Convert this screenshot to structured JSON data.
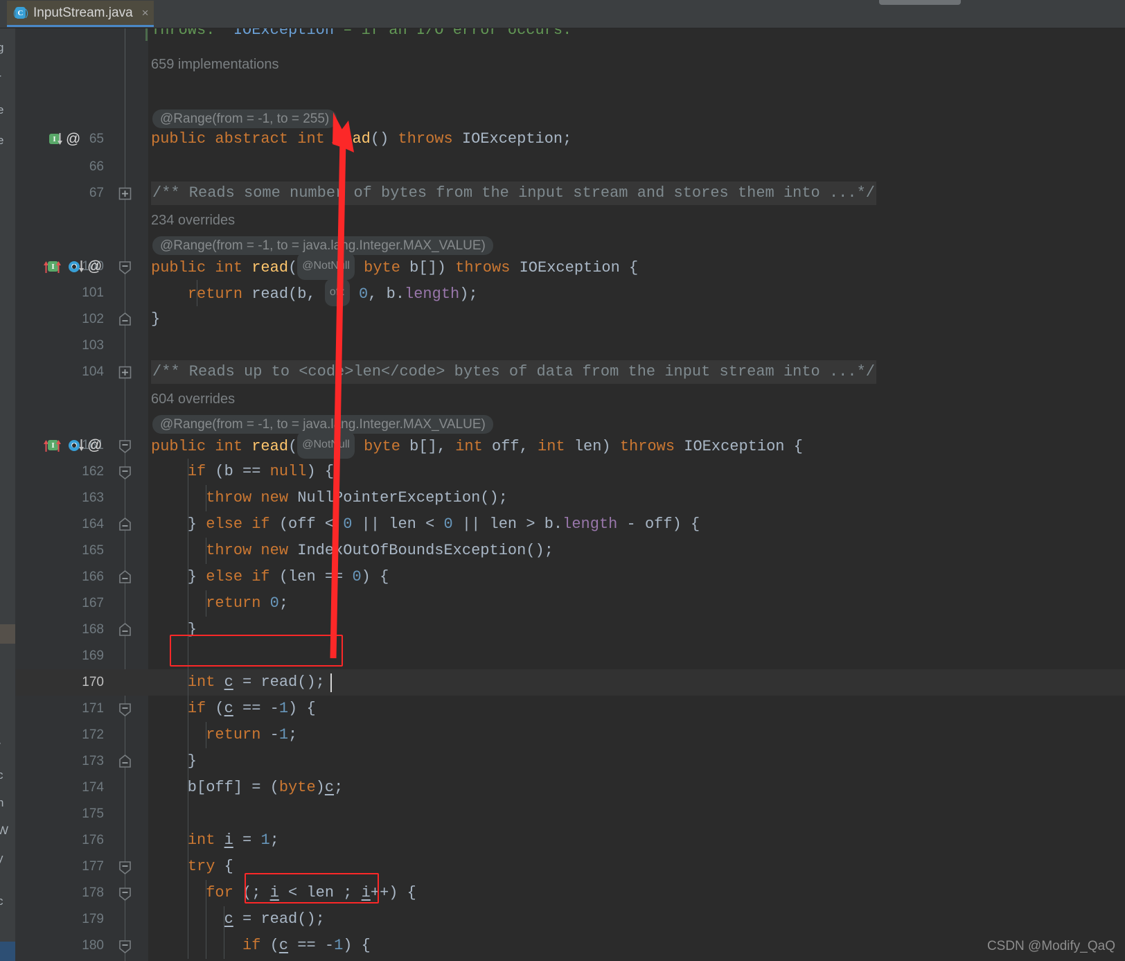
{
  "window": {
    "background_color": "#2b2b2b",
    "gutter_color": "#313335",
    "accent_color": "#4a88c7",
    "annotation_color": "#fc2828"
  },
  "tab": {
    "title": "InputStream.java",
    "icon": "java-class-icon",
    "icon_letter": "C",
    "close_label": "×"
  },
  "top_partial_doc": {
    "label_throws": "Throws:",
    "exception": "IOException",
    "dash_text": "– if an I/O error occurs."
  },
  "hints": {
    "implementations_659": "659 implementations",
    "overrides_234": "234 overrides",
    "overrides_604": "604 overrides"
  },
  "annotations": {
    "range_255": "@Range(from = -1, to = 255)",
    "range_maxvalue": "@Range(from = -1, to = java.lang.Integer.MAX_VALUE)",
    "notnull": "@NotNull",
    "param_off": "off:"
  },
  "folded_docs": {
    "doc_67": "/** Reads some number of bytes from the input stream and stores them into ...*/",
    "doc_104": "/** Reads up to <code>len</code> bytes of data from the input stream into ...*/"
  },
  "lines": [
    {
      "num": "65",
      "gutter": [
        "impl-down",
        "at"
      ],
      "fold": ""
    },
    {
      "num": "66",
      "gutter": [],
      "fold": ""
    },
    {
      "num": "67",
      "gutter": [],
      "fold": "plus"
    },
    {
      "num": "100",
      "gutter": [
        "impl-up",
        "over-down",
        "at"
      ],
      "fold": "minus-down"
    },
    {
      "num": "101",
      "gutter": [],
      "fold": ""
    },
    {
      "num": "102",
      "gutter": [],
      "fold": "minus-up"
    },
    {
      "num": "103",
      "gutter": [],
      "fold": ""
    },
    {
      "num": "104",
      "gutter": [],
      "fold": "plus"
    },
    {
      "num": "161",
      "gutter": [
        "impl-up",
        "over-down",
        "at"
      ],
      "fold": "minus-down"
    },
    {
      "num": "162",
      "gutter": [],
      "fold": "minus-down"
    },
    {
      "num": "163",
      "gutter": [],
      "fold": ""
    },
    {
      "num": "164",
      "gutter": [],
      "fold": "minus-up"
    },
    {
      "num": "165",
      "gutter": [],
      "fold": ""
    },
    {
      "num": "166",
      "gutter": [],
      "fold": "minus-up"
    },
    {
      "num": "167",
      "gutter": [],
      "fold": ""
    },
    {
      "num": "168",
      "gutter": [],
      "fold": "minus-up"
    },
    {
      "num": "169",
      "gutter": [],
      "fold": ""
    },
    {
      "num": "170",
      "gutter": [],
      "fold": ""
    },
    {
      "num": "171",
      "gutter": [],
      "fold": "minus-down"
    },
    {
      "num": "172",
      "gutter": [],
      "fold": ""
    },
    {
      "num": "173",
      "gutter": [],
      "fold": "minus-up"
    },
    {
      "num": "174",
      "gutter": [],
      "fold": ""
    },
    {
      "num": "175",
      "gutter": [],
      "fold": ""
    },
    {
      "num": "176",
      "gutter": [],
      "fold": ""
    },
    {
      "num": "177",
      "gutter": [],
      "fold": "minus-down"
    },
    {
      "num": "178",
      "gutter": [],
      "fold": "minus-down"
    },
    {
      "num": "179",
      "gutter": [],
      "fold": ""
    },
    {
      "num": "180",
      "gutter": [],
      "fold": "minus-down"
    }
  ],
  "code": {
    "l65": "public abstract int read() throws IOException;",
    "l100": "public int read( byte b[]) throws IOException {",
    "l101": "return read(b,  0, b.length);",
    "l102": "}",
    "l161": "public int read( byte b[], int off, int len) throws IOException {",
    "l162": "if (b == null) {",
    "l163": "throw new NullPointerException();",
    "l164": "} else if (off < 0 || len < 0 || len > b.length - off) {",
    "l165": "throw new IndexOutOfBoundsException();",
    "l166": "} else if (len == 0) {",
    "l167": "return 0;",
    "l168": "}",
    "l170": "int c = read();",
    "l171": "if (c == -1) {",
    "l172": "return -1;",
    "l173": "}",
    "l174": "b[off] = (byte)c;",
    "l176": "int i = 1;",
    "l177": "try {",
    "l178": "for (; i < len ; i++) {",
    "l179": "c = read();",
    "l180": "if (c == -1) {"
  },
  "current_line_number": "170",
  "sidebar_fragments": [
    "g",
    "r",
    "e",
    "e",
    "/",
    "c",
    "h",
    "W",
    "y",
    "c"
  ],
  "watermark": "CSDN @Modify_QaQ"
}
